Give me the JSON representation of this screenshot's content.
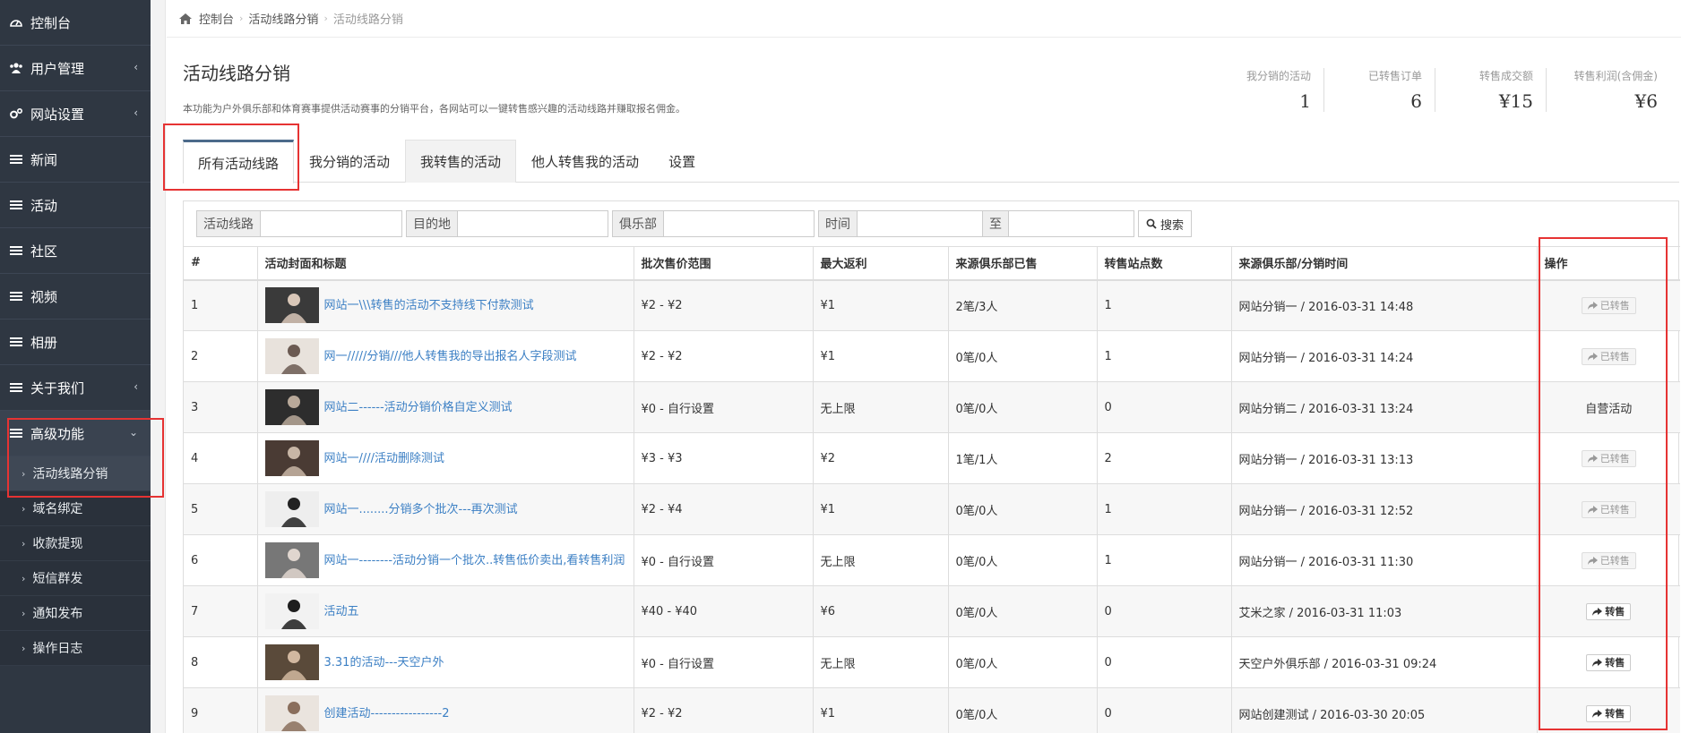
{
  "breadcrumb": {
    "home": "控制台",
    "parent": "活动线路分销",
    "current": "活动线路分销"
  },
  "sidebar": {
    "items": [
      {
        "label": "控制台",
        "icon": "dashboard-icon",
        "caret": ""
      },
      {
        "label": "用户管理",
        "icon": "users-icon",
        "caret": "‹"
      },
      {
        "label": "网站设置",
        "icon": "gears-icon",
        "caret": "‹"
      },
      {
        "label": "新闻",
        "icon": "list-icon",
        "caret": ""
      },
      {
        "label": "活动",
        "icon": "list-icon",
        "caret": ""
      },
      {
        "label": "社区",
        "icon": "list-icon",
        "caret": ""
      },
      {
        "label": "视频",
        "icon": "list-icon",
        "caret": ""
      },
      {
        "label": "相册",
        "icon": "list-icon",
        "caret": ""
      },
      {
        "label": "关于我们",
        "icon": "list-icon",
        "caret": "‹"
      },
      {
        "label": "高级功能",
        "icon": "list-icon",
        "caret": "⌄"
      }
    ],
    "subitems": [
      "活动线路分销",
      "域名绑定",
      "收款提现",
      "短信群发",
      "通知发布",
      "操作日志"
    ]
  },
  "page": {
    "title": "活动线路分销",
    "description": "本功能为户外俱乐部和体育赛事提供活动赛事的分销平台，各网站可以一键转售感兴趣的活动线路并赚取报名佣金。"
  },
  "stats": [
    {
      "label": "我分销的活动",
      "value": "1"
    },
    {
      "label": "已转售订单",
      "value": "6"
    },
    {
      "label": "转售成交额",
      "value": "¥15"
    },
    {
      "label": "转售利润(含佣金)",
      "value": "¥6"
    }
  ],
  "tabs": [
    "所有活动线路",
    "我分销的活动",
    "我转售的活动",
    "他人转售我的活动",
    "设置"
  ],
  "filters": {
    "route_label": "活动线路",
    "dest_label": "目的地",
    "club_label": "俱乐部",
    "time_label": "时间",
    "to_label": "至",
    "search_label": "搜索"
  },
  "table": {
    "columns": [
      "#",
      "活动封面和标题",
      "批次售价范围",
      "最大返利",
      "来源俱乐部已售",
      "转售站点数",
      "来源俱乐部/分销时间",
      "操作"
    ],
    "rows": [
      {
        "num": "1",
        "title": "网站一\\\\\\转售的活动不支持线下付款测试",
        "price": "¥2 - ¥2",
        "rebate": "¥1",
        "sold": "2笔/3人",
        "sites": "1",
        "source": "网站分销一 / 2016-03-31 14:48",
        "op": "已转售",
        "op_type": "disabled"
      },
      {
        "num": "2",
        "title": "网一/////分销///他人转售我的导出报名人字段测试",
        "price": "¥2 - ¥2",
        "rebate": "¥1",
        "sold": "0笔/0人",
        "sites": "1",
        "source": "网站分销一 / 2016-03-31 14:24",
        "op": "已转售",
        "op_type": "disabled"
      },
      {
        "num": "3",
        "title": "网站二------活动分销价格自定义测试",
        "price": "¥0 - 自行设置",
        "rebate": "无上限",
        "sold": "0笔/0人",
        "sites": "0",
        "source": "网站分销二 / 2016-03-31 13:24",
        "op": "自营活动",
        "op_type": "text"
      },
      {
        "num": "4",
        "title": "网站一////活动删除测试",
        "price": "¥3 - ¥3",
        "rebate": "¥2",
        "sold": "1笔/1人",
        "sites": "2",
        "source": "网站分销一 / 2016-03-31 13:13",
        "op": "已转售",
        "op_type": "disabled"
      },
      {
        "num": "5",
        "title": "网站一........分销多个批次---再次测试",
        "price": "¥2 - ¥4",
        "rebate": "¥1",
        "sold": "0笔/0人",
        "sites": "1",
        "source": "网站分销一 / 2016-03-31 12:52",
        "op": "已转售",
        "op_type": "disabled"
      },
      {
        "num": "6",
        "title": "网站一--------活动分销一个批次..转售低价卖出,看转售利润",
        "price": "¥0 - 自行设置",
        "rebate": "无上限",
        "sold": "0笔/0人",
        "sites": "1",
        "source": "网站分销一 / 2016-03-31 11:30",
        "op": "已转售",
        "op_type": "disabled"
      },
      {
        "num": "7",
        "title": "活动五",
        "price": "¥40 - ¥40",
        "rebate": "¥6",
        "sold": "0笔/0人",
        "sites": "0",
        "source": "艾米之家 / 2016-03-31 11:03",
        "op": "转售",
        "op_type": "enabled"
      },
      {
        "num": "8",
        "title": "3.31的活动---天空户外",
        "price": "¥0 - 自行设置",
        "rebate": "无上限",
        "sold": "0笔/0人",
        "sites": "0",
        "source": "天空户外俱乐部 / 2016-03-31 09:24",
        "op": "转售",
        "op_type": "enabled"
      },
      {
        "num": "9",
        "title": "创建活动-----------------2",
        "price": "¥2 - ¥2",
        "rebate": "¥1",
        "sold": "0笔/0人",
        "sites": "0",
        "source": "网站创建测试 / 2016-03-30 20:05",
        "op": "转售",
        "op_type": "enabled"
      }
    ]
  }
}
